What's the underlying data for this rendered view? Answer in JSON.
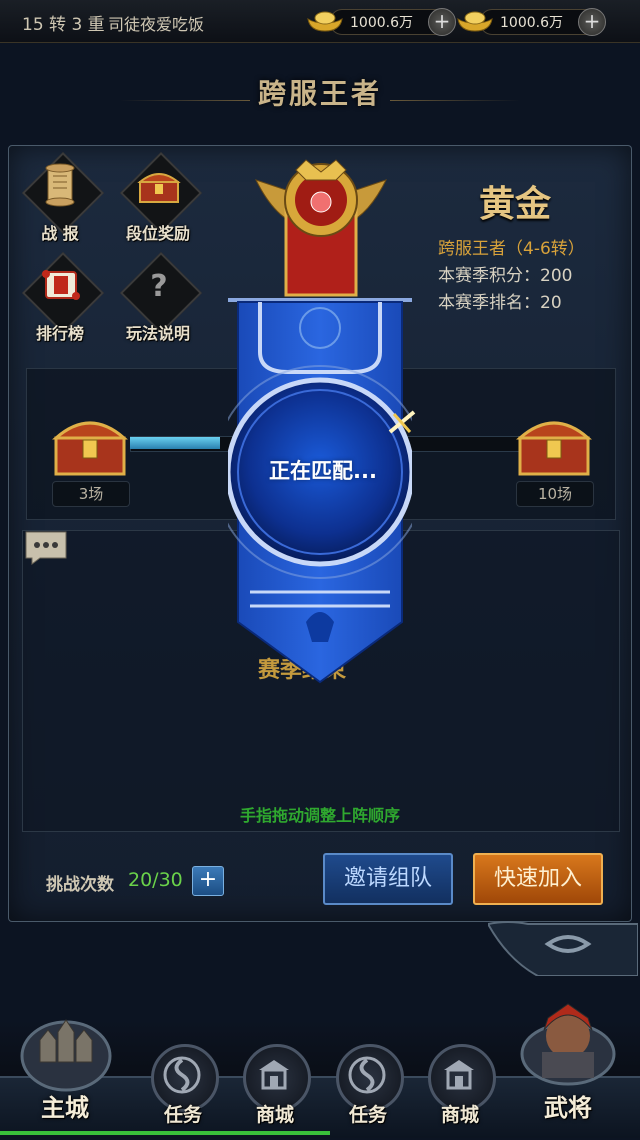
{
  "header": {
    "level": "15 转 3 重",
    "player_name": "司徒夜爱吃饭",
    "currency": [
      {
        "icon": "gold-ingot-icon",
        "value": "1000.6万"
      },
      {
        "icon": "silver-ingot-icon",
        "value": "1000.6万"
      }
    ]
  },
  "title": "跨服王者",
  "menu": [
    {
      "label": "战 报",
      "icon": "scroll-icon"
    },
    {
      "label": "段位奖励",
      "icon": "treasure-chest-icon"
    },
    {
      "label": "排行榜",
      "icon": "ranking-scroll-icon"
    },
    {
      "label": "玩法说明",
      "icon": "question-mark-icon"
    }
  ],
  "rank": {
    "name": "黄金",
    "tier": "跨服王者（4-6转）",
    "score": "本赛季积分：200",
    "rank": "本赛季排名：20"
  },
  "progress": {
    "milestones": [
      "3场",
      "10场"
    ],
    "fill_fraction": 0.23
  },
  "team": {
    "season_end": "赛季结束",
    "drag_hint": "手指拖动调整上阵顺序"
  },
  "challenge": {
    "label": "挑战次数",
    "count": "20/30"
  },
  "buttons": {
    "invite": "邀请组队",
    "quick_join": "快速加入"
  },
  "overlay": {
    "matching": "正在匹配..."
  },
  "nav": [
    {
      "label": "主城",
      "icon": "city-icon"
    },
    {
      "label": "任务",
      "icon": "swirl-icon"
    },
    {
      "label": "商城",
      "icon": "shop-icon"
    },
    {
      "label": "任务",
      "icon": "swirl-icon"
    },
    {
      "label": "商城",
      "icon": "shop-icon"
    },
    {
      "label": "武将",
      "icon": "general-portrait-icon"
    }
  ],
  "colors": {
    "gold_text": "#e5c582",
    "tier_text": "#d8a23a",
    "hint_green": "#2fa82f",
    "invite_blue": "#1f4a8c",
    "quick_orange": "#d8781c",
    "banner_blue": "#1e56c8"
  }
}
